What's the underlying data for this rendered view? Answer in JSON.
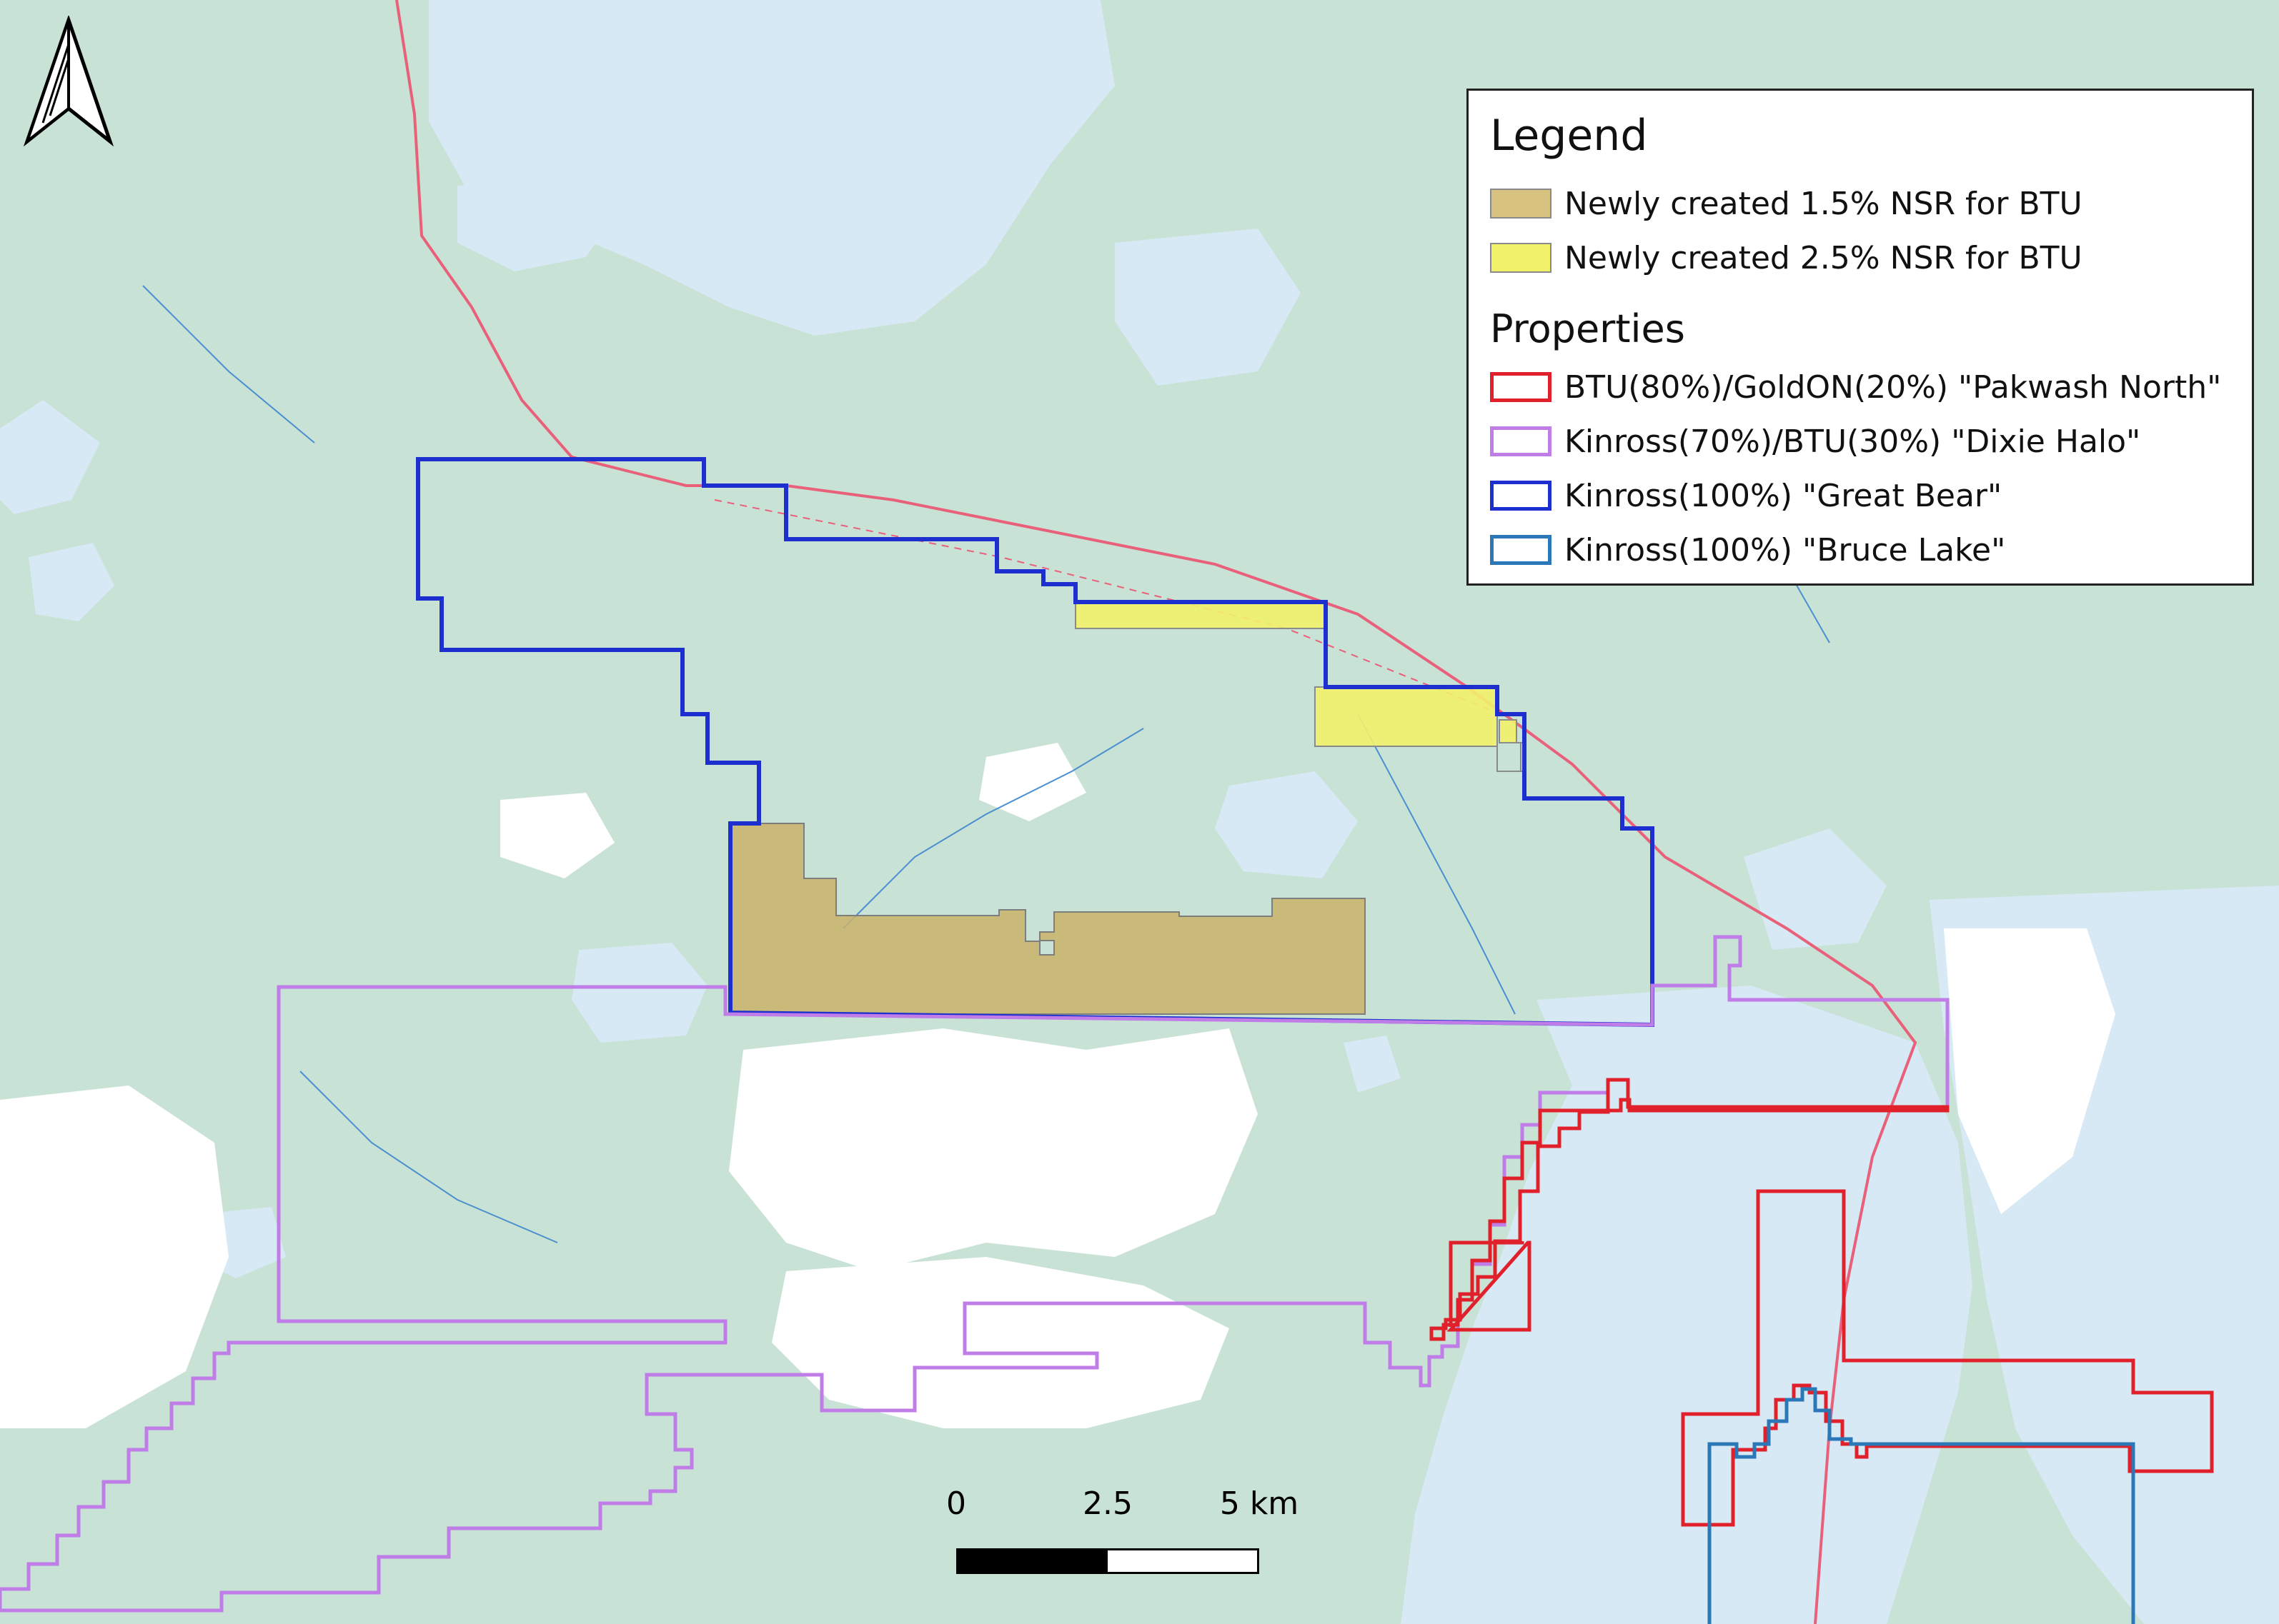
{
  "colors": {
    "land": "#c9e2d6",
    "water": "#d7e9f5",
    "clearing": "#ffffff",
    "contour": "#c98b6a",
    "stream": "#4a8fcf",
    "road": "#e8607a",
    "nsr_15": "#c9b36a",
    "nsr_25": "#f2f26a",
    "pakwash_north": "#e0202a",
    "dixie_halo": "#c07de8",
    "great_bear": "#1d2fcf",
    "bruce_lake": "#2a78b8"
  },
  "legend": {
    "title": "Legend",
    "items": [
      {
        "label": "Newly created 1.5% NSR for BTU",
        "color": "#d8c27f",
        "style": "fill"
      },
      {
        "label": "Newly created 2.5% NSR for BTU",
        "color": "#f2f26a",
        "style": "fill"
      }
    ],
    "properties_title": "Properties",
    "properties": [
      {
        "label": "BTU(80%)/GoldON(20%) \"Pakwash North\"",
        "color": "#e0202a",
        "style": "outline"
      },
      {
        "label": "Kinross(70%)/BTU(30%) \"Dixie Halo\"",
        "color": "#c07de8",
        "style": "outline"
      },
      {
        "label": "Kinross(100%) \"Great Bear\"",
        "color": "#1d2fcf",
        "style": "outline"
      },
      {
        "label": "Kinross(100%) \"Bruce Lake\"",
        "color": "#2a78b8",
        "style": "outline"
      }
    ]
  },
  "scale_bar": {
    "ticks": [
      "0",
      "2.5",
      "5 km"
    ]
  },
  "north_arrow": {
    "icon": "north-arrow-icon"
  }
}
